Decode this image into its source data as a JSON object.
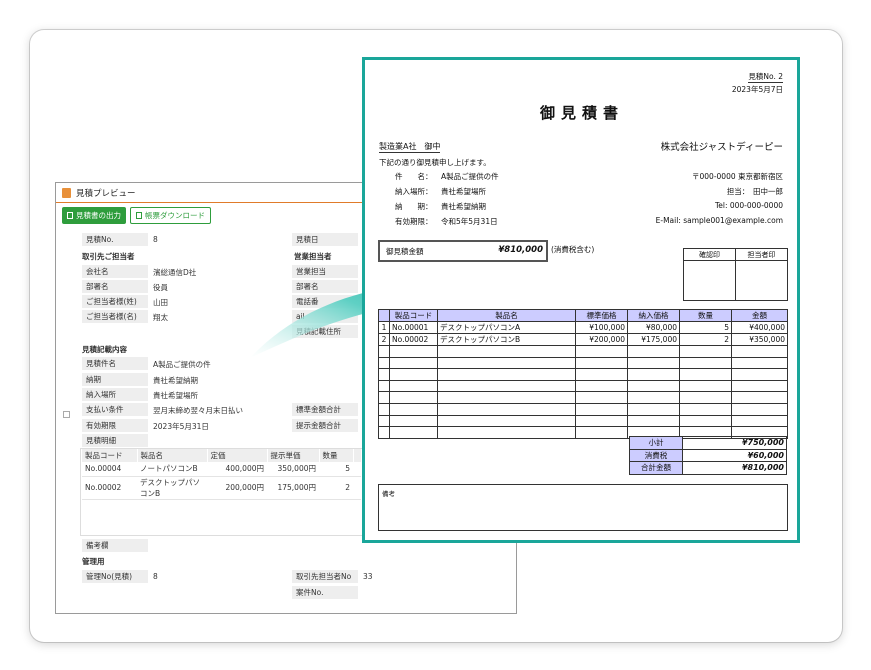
{
  "window": {
    "title": "見積プレビュー",
    "btn_output": "見積書の出力",
    "btn_download": "帳票ダウンロード",
    "fields": {
      "estimate_no_label": "見積No.",
      "estimate_no": "8",
      "estimate_date_label": "見積日",
      "client_section": "取引先ご担当者",
      "sales_section": "営業担当者",
      "company_label": "会社名",
      "company": "濱総通信D社",
      "sales_person_label": "営業担当",
      "dept_label": "部署名",
      "dept": "役員",
      "dept2_label": "部署名",
      "last_label": "ご担当者様(姓)",
      "last": "山田",
      "phone_label": "電話番",
      "first_label": "ご担当者様(名)",
      "first": "翔太",
      "mail_label": "ail",
      "remarks_place_label": "見積記載住所",
      "detail_section": "見積記載内容",
      "subject_label": "見積件名",
      "subject": "A製品ご提供の件",
      "deadline_label": "納期",
      "deadline": "貴社希望納期",
      "place_label": "納入場所",
      "place": "貴社希望場所",
      "pay_label": "支払い条件",
      "pay": "翌月末締め翌々月末日払い",
      "std_total_label": "標準金額合計",
      "valid_label": "有効期限",
      "valid": "2023年5月31日",
      "offer_total_label": "提示金額合計",
      "items_label": "見積明細",
      "memo_label": "備考欄",
      "mgmt_section": "管理用",
      "mgmt_no_label": "管理No(見積)",
      "mgmt_no": "8",
      "client_no_label": "取引先担当者No",
      "client_no": "33",
      "case_no_label": "案件No."
    },
    "items_headers": [
      "製品コード",
      "製品名",
      "定価",
      "提示単価",
      "数量",
      ""
    ],
    "items": [
      {
        "code": "No.00004",
        "name": "ノートパソコンB",
        "list": "400,000円",
        "offer": "350,000円",
        "qty": "5"
      },
      {
        "code": "No.00002",
        "name": "デスクトップパソコンB",
        "list": "200,000円",
        "offer": "175,000円",
        "qty": "2"
      }
    ]
  },
  "doc": {
    "estimate_no": "見積No. 2",
    "date": "2023年5月7日",
    "title": "御見積書",
    "client": "製造業A社　御中",
    "issuer": "株式会社ジャストディーピー",
    "intro": "下記の通り御見積申し上げます。",
    "subject_label": "件　　名：",
    "subject": "A製品ご提供の件",
    "place_label": "納入場所：",
    "place": "貴社希望場所",
    "deadline_label": "納　　期：",
    "deadline": "貴社希望納期",
    "valid_label": "有効期限：",
    "valid": "令和5年5月31日",
    "address": "〒000-0000 東京都新宿区",
    "person": "担当：　田中一郎",
    "tel": "Tel: 000-000-0000",
    "email": "E-Mail: sample001@example.com",
    "total_label": "御見積金額",
    "total": "¥810,000",
    "tax_note": "(消費税含む)",
    "stamp_confirm": "確認印",
    "stamp_person": "担当者印",
    "table_headers": [
      "",
      "製品コード",
      "製品名",
      "標準価格",
      "納入価格",
      "数量",
      "金額"
    ],
    "rows": [
      {
        "no": "1",
        "code": "No.00001",
        "name": "デスクトップパソコンA",
        "std": "¥100,000",
        "price": "¥80,000",
        "qty": "5",
        "amount": "¥400,000"
      },
      {
        "no": "2",
        "code": "No.00002",
        "name": "デスクトップパソコンB",
        "std": "¥200,000",
        "price": "¥175,000",
        "qty": "2",
        "amount": "¥350,000"
      }
    ],
    "subtotal_label": "小計",
    "subtotal": "¥750,000",
    "tax_label": "消費税",
    "tax": "¥60,000",
    "grand_label": "合計金額",
    "grand": "¥810,000",
    "remarks_label": "備考"
  },
  "colors": {
    "accent": "#1aa69a",
    "button_green": "#2e9d3c",
    "header_fill": "#ccccff",
    "title_line": "#e07b2a"
  }
}
